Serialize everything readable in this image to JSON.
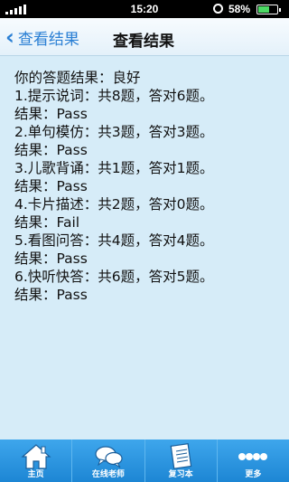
{
  "status_bar": {
    "time": "15:20",
    "battery_percent": "58%",
    "battery_level": 0.58
  },
  "nav": {
    "back_label": "查看结果",
    "title": "查看结果"
  },
  "content": {
    "lines": [
      "你的答题结果：良好",
      "1.提示说词：共8题，答对6题。",
      "结果：Pass",
      "2.单句模仿：共3题，答对3题。",
      "结果：Pass",
      "3.儿歌背诵：共1题，答对1题。",
      "结果：Pass",
      "4.卡片描述：共2题，答对0题。",
      "结果：Fail",
      "5.看图问答：共4题，答对4题。",
      "结果：Pass",
      "6.快听快答：共6题，答对5题。",
      "结果：Pass"
    ]
  },
  "tab_bar": {
    "tabs": [
      {
        "label": "主页",
        "icon": "home-icon"
      },
      {
        "label": "在线老师",
        "icon": "chat-bubbles-icon"
      },
      {
        "label": "复习本",
        "icon": "notebook-icon"
      },
      {
        "label": "更多",
        "icon": "more-dots-icon"
      }
    ]
  }
}
